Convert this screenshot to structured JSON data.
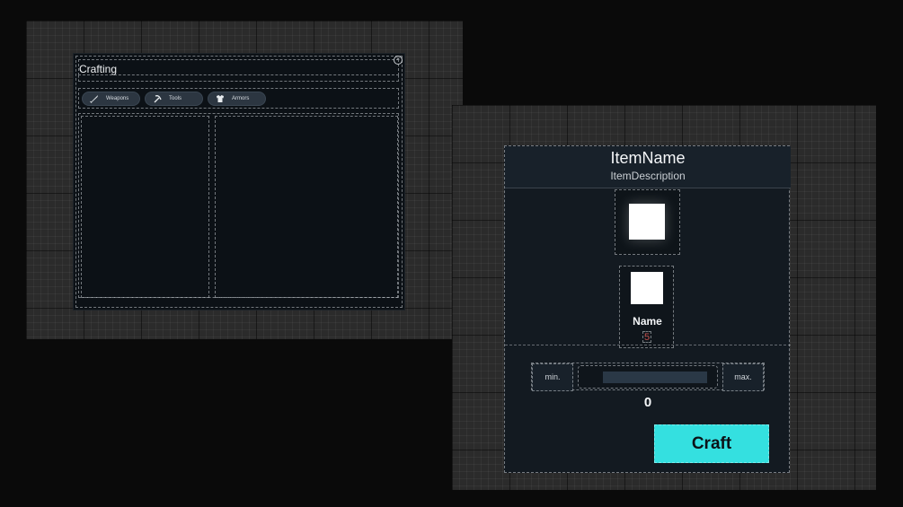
{
  "crafting_window": {
    "title": "Crafting",
    "close_symbol": "×",
    "tabs": [
      {
        "label": "Weapons",
        "icon": "sword-icon"
      },
      {
        "label": "Tools",
        "icon": "pickaxe-icon"
      },
      {
        "label": "Armors",
        "icon": "armor-icon"
      }
    ]
  },
  "item_detail": {
    "name": "ItemName",
    "description": "ItemDescription",
    "ingredient": {
      "name": "Name",
      "quantity": "5"
    },
    "min_label": "min.",
    "max_label": "max.",
    "quantity": "0",
    "craft_label": "Craft"
  },
  "colors": {
    "background": "#0a0a0a",
    "panel": "#0c1116",
    "detail_panel": "#131a21",
    "tab": "#2c3641",
    "craft_button": "#34e0e0",
    "quantity_text": "#c0504d"
  }
}
